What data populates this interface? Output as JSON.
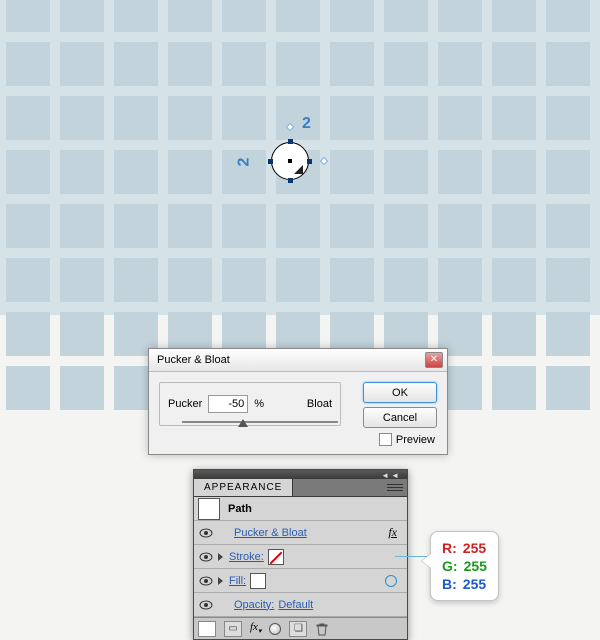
{
  "canvas": {
    "dim_top": "2",
    "dim_left": "2"
  },
  "dialog": {
    "title": "Pucker & Bloat",
    "pucker_label": "Pucker",
    "value": "-50",
    "percent": "%",
    "bloat_label": "Bloat",
    "ok": "OK",
    "cancel": "Cancel",
    "preview": "Preview"
  },
  "panel": {
    "title": "APPEARANCE",
    "path": "Path",
    "effect": "Pucker & Bloat",
    "stroke_label": "Stroke:",
    "fill_label": "Fill:",
    "opacity_label": "Opacity:",
    "opacity_value": "Default",
    "fx": "fx"
  },
  "rgb": {
    "r_label": "R:",
    "r_val": "255",
    "g_label": "G:",
    "g_val": "255",
    "b_label": "B:",
    "b_val": "255"
  }
}
